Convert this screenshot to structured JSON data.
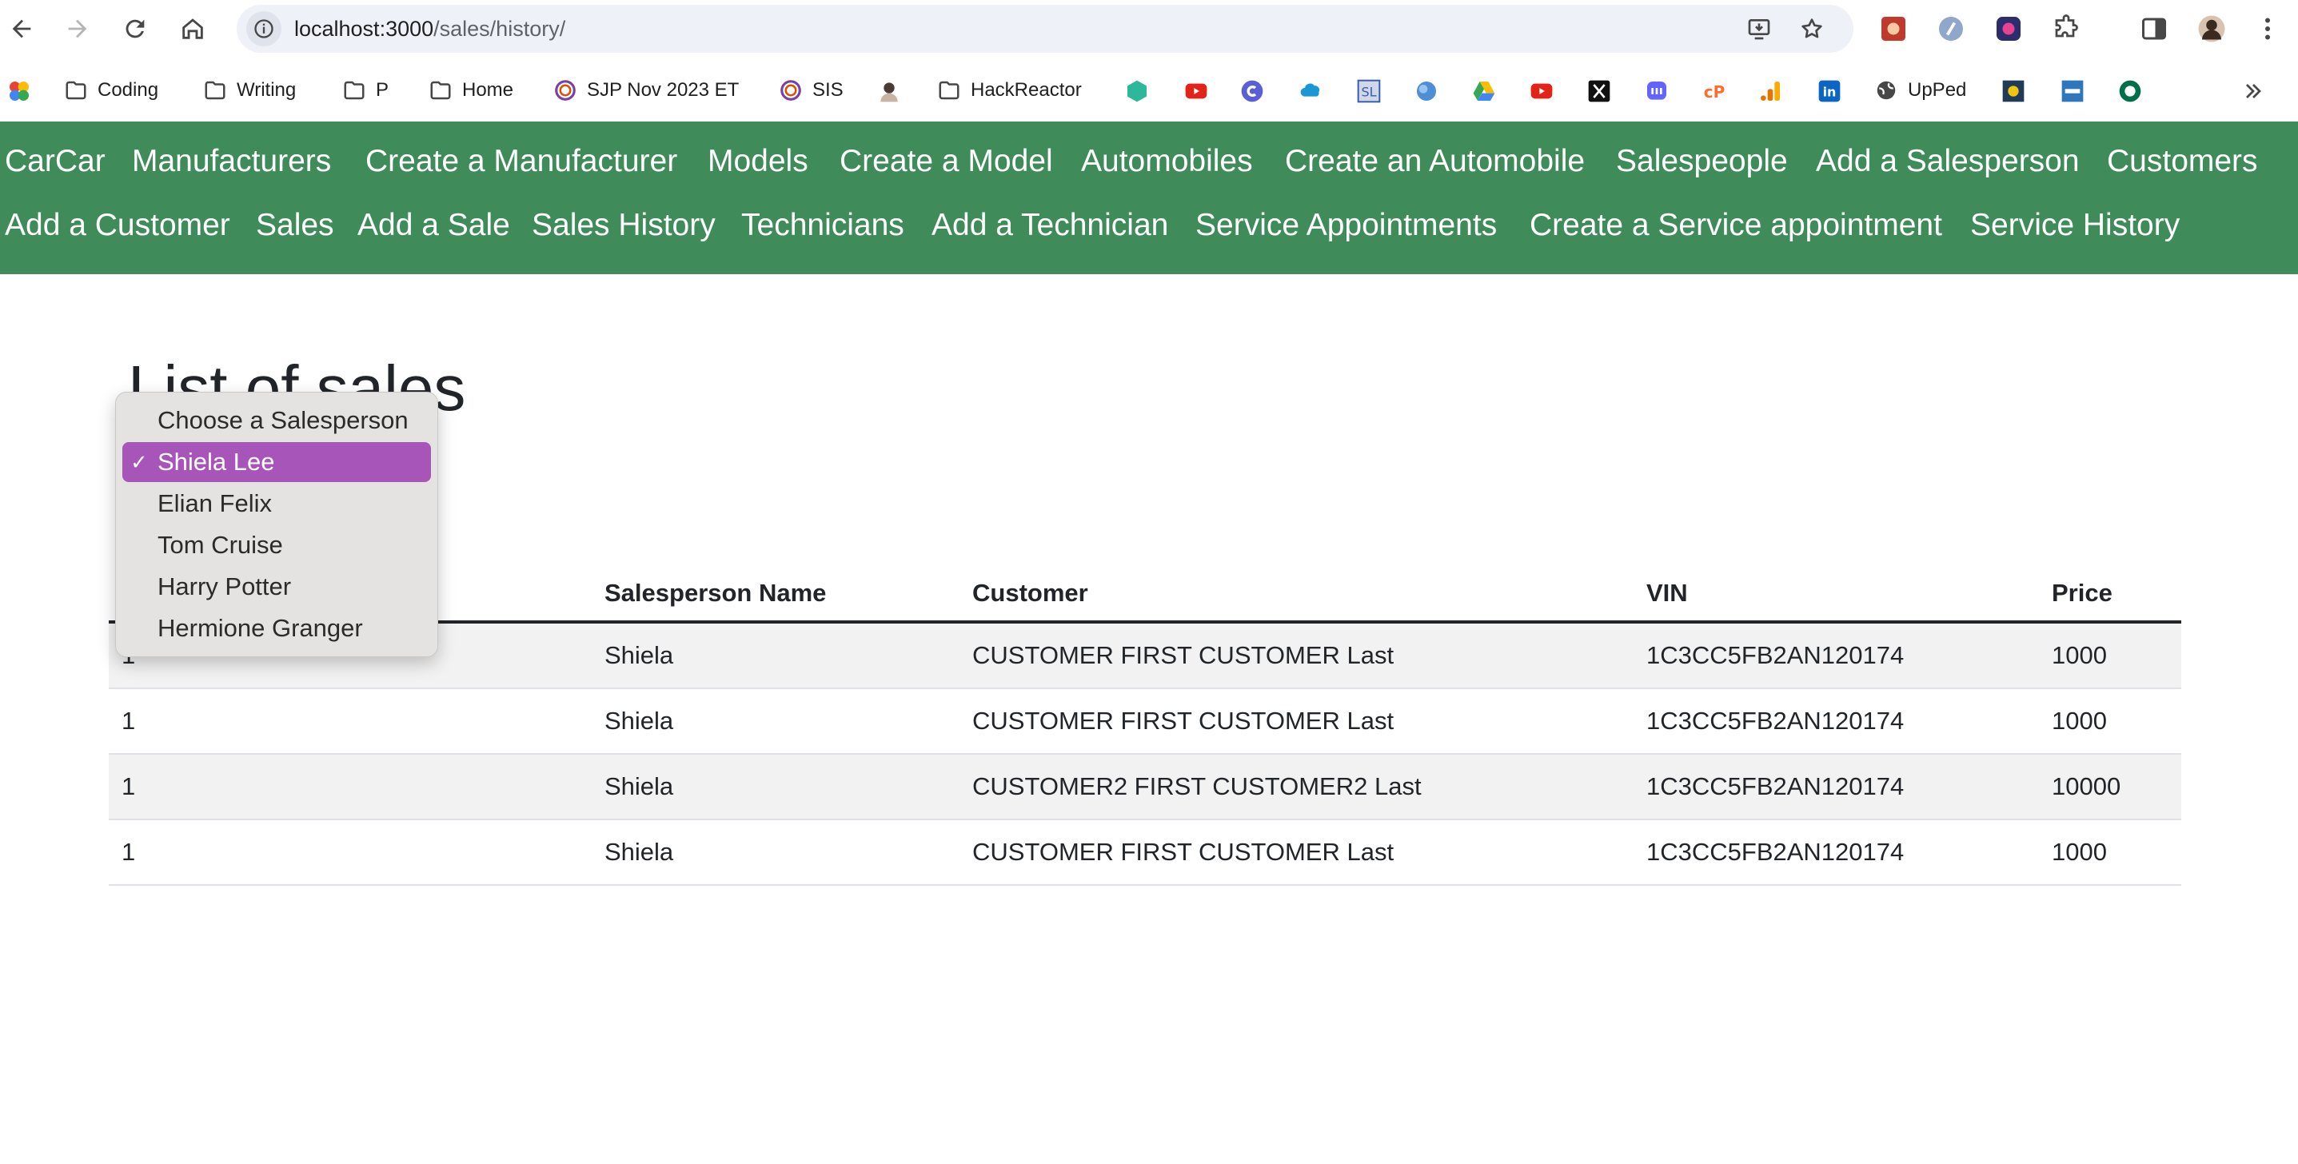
{
  "browser": {
    "url_host": "localhost:3000",
    "url_path": "/sales/history/",
    "bookmarks": [
      {
        "label": "Coding",
        "icon": "folder-icon"
      },
      {
        "label": "Writing",
        "icon": "folder-icon"
      },
      {
        "label": "P",
        "icon": "folder-icon"
      },
      {
        "label": "Home",
        "icon": "folder-icon"
      },
      {
        "label": "SJP Nov 2023 ET",
        "icon": "circle-logo-icon"
      },
      {
        "label": "SIS",
        "icon": "circle-logo-icon"
      },
      {
        "label": "HackReactor",
        "icon": "folder-icon"
      },
      {
        "label": "UpPed",
        "icon": "globe-icon"
      }
    ]
  },
  "navbar": {
    "brand": "CarCar",
    "row1": [
      "Manufacturers",
      "Create a Manufacturer",
      "Models",
      "Create a Model",
      "Automobiles",
      "Create an Automobile",
      "Salespeople",
      "Add a Salesperson",
      "Customers"
    ],
    "row2": [
      "Add a Customer",
      "Sales",
      "Add a Sale",
      "Sales History",
      "Technicians",
      "Add a Technician",
      "Service Appointments",
      "Create a Service appointment",
      "Service History"
    ]
  },
  "page": {
    "heading": "List of sales"
  },
  "salesperson_select": {
    "options": [
      "Choose a Salesperson",
      "Shiela Lee",
      "Elian Felix",
      "Tom Cruise",
      "Harry Potter",
      "Hermione Granger"
    ],
    "selected": "Shiela Lee",
    "checkmark": "✓"
  },
  "table": {
    "headers": [
      "Salesperson Name",
      "Customer",
      "VIN",
      "Price"
    ],
    "rows": [
      {
        "id": "1",
        "salesperson": "Shiela",
        "customer": "CUSTOMER FIRST CUSTOMER Last",
        "vin": "1C3CC5FB2AN120174",
        "price": "1000"
      },
      {
        "id": "1",
        "salesperson": "Shiela",
        "customer": "CUSTOMER FIRST CUSTOMER Last",
        "vin": "1C3CC5FB2AN120174",
        "price": "1000"
      },
      {
        "id": "1",
        "salesperson": "Shiela",
        "customer": "CUSTOMER2 FIRST CUSTOMER2 Last",
        "vin": "1C3CC5FB2AN120174",
        "price": "10000"
      },
      {
        "id": "1",
        "salesperson": "Shiela",
        "customer": "CUSTOMER FIRST CUSTOMER Last",
        "vin": "1C3CC5FB2AN120174",
        "price": "1000"
      }
    ]
  },
  "colors": {
    "navbar": "#3f8c5a",
    "selected_option": "#a855b9"
  }
}
